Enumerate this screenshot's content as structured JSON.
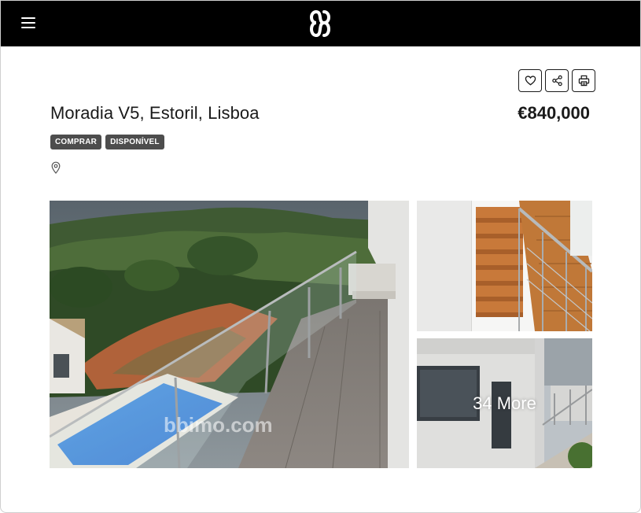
{
  "header": {
    "menu_icon": "hamburger-menu-icon",
    "logo_icon": "brand-monogram-logo",
    "background": "#000000"
  },
  "actions": {
    "favorite_icon": "heart-icon",
    "share_icon": "share-icon",
    "print_icon": "printer-icon"
  },
  "listing": {
    "title": "Moradia V5, Estoril, Lisboa",
    "price": "€840,000",
    "badges": [
      "COMPRAR",
      "DISPONÍVEL"
    ],
    "location_icon": "map-pin-icon"
  },
  "gallery": {
    "more_label": "34 More",
    "watermark": "bbimo.com"
  },
  "colors": {
    "badge_bg": "#4d4d4d",
    "text": "#1a1a1a"
  }
}
